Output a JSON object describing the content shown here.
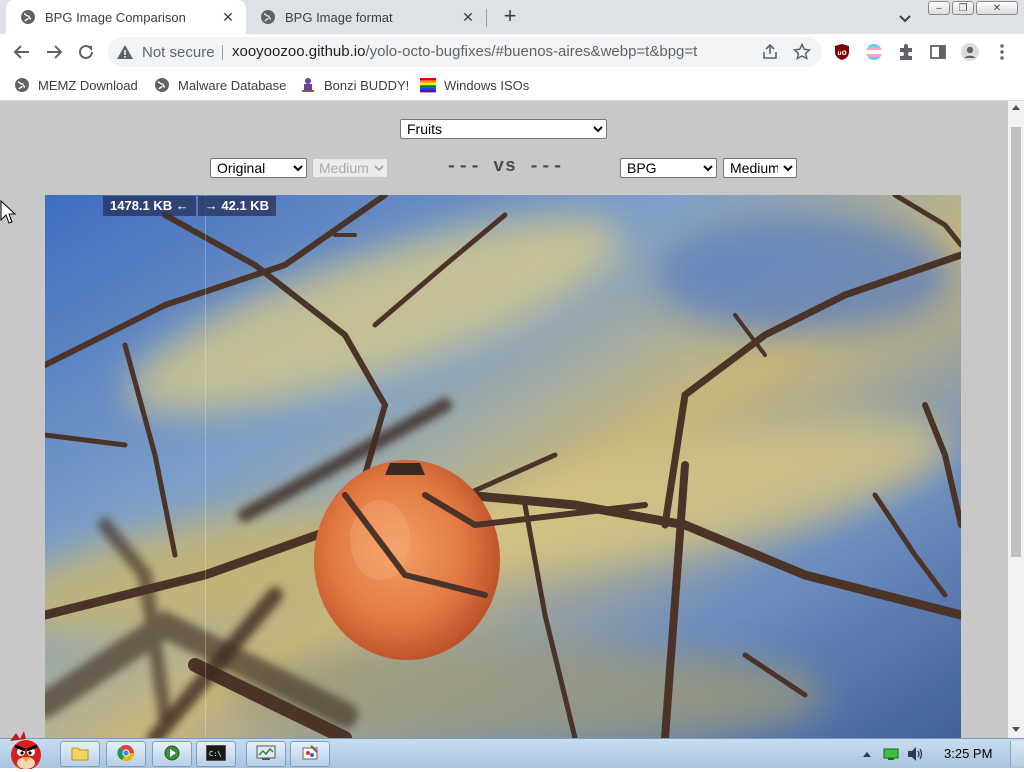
{
  "browser": {
    "tabs": [
      {
        "title": "BPG Image Comparison",
        "active": true
      },
      {
        "title": "BPG Image format",
        "active": false
      }
    ],
    "new_tab_label": "+",
    "window_controls": {
      "minimize": "–",
      "restore": "❐",
      "close": "✕"
    }
  },
  "toolbar": {
    "security_label": "Not secure",
    "url_host": "xooyoozoo.github.io",
    "url_path": "/yolo-octo-bugfixes/#buenos-aires&webp=t&bpg=t"
  },
  "bookmarks": [
    {
      "label": "MEMZ Download",
      "icon": "globe-icon"
    },
    {
      "label": "Malware Database",
      "icon": "globe-icon"
    },
    {
      "label": "Bonzi BUDDY!",
      "icon": "bonzi-icon"
    },
    {
      "label": "Windows ISOs",
      "icon": "windows-flag-icon"
    }
  ],
  "page": {
    "image_set": {
      "selected": "Fruits"
    },
    "left": {
      "format": "Original",
      "quality": "Medium"
    },
    "vs_text": "--- vs ---",
    "right": {
      "format": "BPG",
      "quality": "Medium"
    },
    "sizes": {
      "left": "1478.1 KB ←",
      "right": "→ 42.1 KB"
    }
  },
  "taskbar": {
    "clock": "3:25 PM",
    "colors": {
      "bar": "#b3cbe4",
      "accent": "#7d9bc0"
    }
  }
}
